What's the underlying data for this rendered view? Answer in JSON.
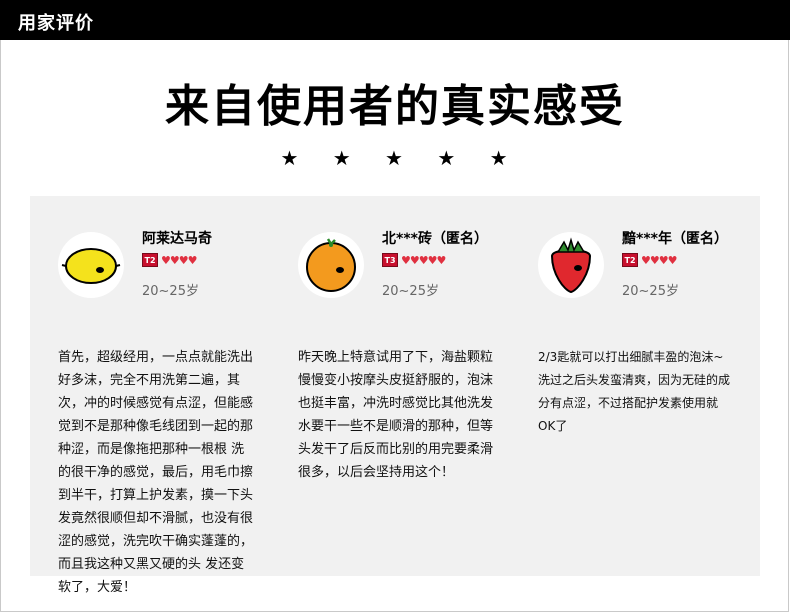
{
  "header": {
    "title": "用家评价"
  },
  "main": {
    "title": "来自使用者的真实感受",
    "stars": "★ ★ ★ ★ ★"
  },
  "colors": {
    "panel_bg": "#f1f1f1",
    "header_bg": "#000000",
    "heart": "#e03040",
    "badge": "#c8102e"
  },
  "reviews": [
    {
      "avatar_icon": "lemon-icon",
      "name": "阿莱达马奇",
      "level": "T2",
      "hearts": "♥♥♥♥",
      "age": "20~25岁",
      "text": "首先，超级经用，一点点就能洗出好多沫，完全不用洗第二遍，其次，冲的时候感觉有点涩，但能感觉到不是那种像毛线团到一起的那种涩，而是像拖把那种一根根 洗的很干净的感觉，最后，用毛巾擦到半干，打算上护发素，摸一下头发竟然很顺但却不滑腻，也没有很涩的感觉，洗完吹干确实蓬蓬的，而且我这种又黑又硬的头 发还变软了，大爱！"
    },
    {
      "avatar_icon": "orange-icon",
      "name": "北***砖（匿名）",
      "level": "T3",
      "hearts": "♥♥♥♥♥",
      "age": "20~25岁",
      "text": "昨天晚上特意试用了下，海盐颗粒慢慢变小按摩头皮挺舒服的，泡沫也挺丰富，冲洗时感觉比其他洗发水要干一些不是顺滑的那种，但等头发干了后反而比别的用完要柔滑很多，以后会坚持用这个！"
    },
    {
      "avatar_icon": "strawberry-icon",
      "name": "黯***年（匿名）",
      "level": "T2",
      "hearts": "♥♥♥♥",
      "age": "20~25岁",
      "text": "2/3匙就可以打出细腻丰盈的泡沫~洗过之后头发蛮清爽，因为无硅的成分有点涩，不过搭配护发素使用就OK了"
    }
  ]
}
